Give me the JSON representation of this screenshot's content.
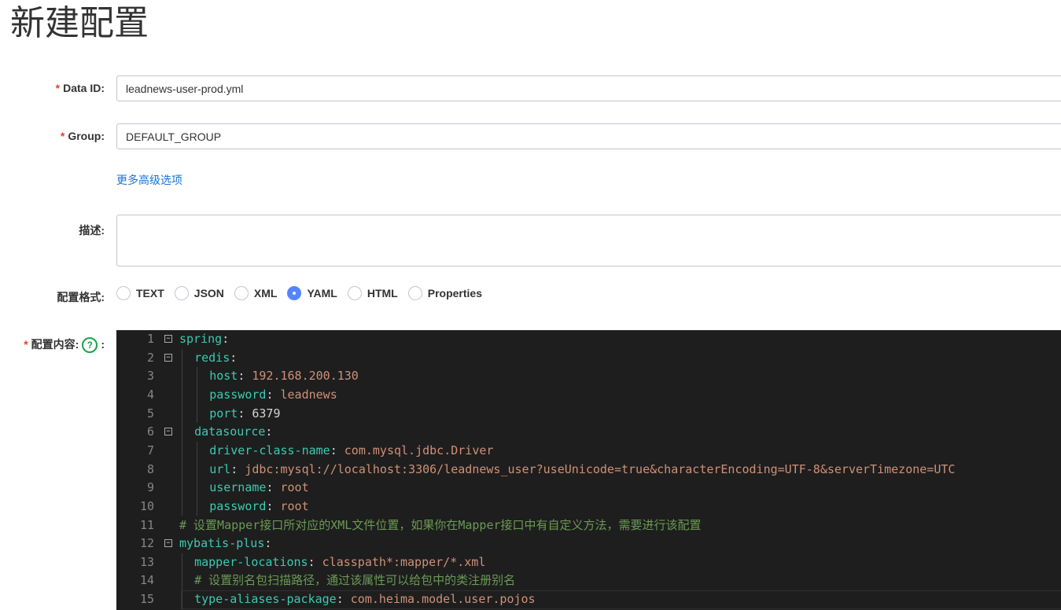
{
  "page_title": "新建配置",
  "form": {
    "data_id": {
      "label": "Data ID:",
      "value": "leadnews-user-prod.yml"
    },
    "group": {
      "label": "Group:",
      "value": "DEFAULT_GROUP"
    },
    "advanced_link": "更多高级选项",
    "description": {
      "label": "描述:",
      "value": ""
    },
    "format": {
      "label": "配置格式:",
      "options": [
        "TEXT",
        "JSON",
        "XML",
        "YAML",
        "HTML",
        "Properties"
      ],
      "selected": "YAML"
    },
    "content": {
      "label": "配置内容:",
      "help_icon": "?",
      "colon": ":"
    },
    "required_mark": "*"
  },
  "editor": {
    "lines": [
      {
        "n": "1",
        "indent": 0,
        "fold": true,
        "key": "spring",
        "value": ""
      },
      {
        "n": "2",
        "indent": 1,
        "fold": true,
        "key": "redis",
        "value": ""
      },
      {
        "n": "3",
        "indent": 2,
        "key": "host",
        "value": "192.168.200.130"
      },
      {
        "n": "4",
        "indent": 2,
        "key": "password",
        "value": "leadnews"
      },
      {
        "n": "5",
        "indent": 2,
        "key": "port",
        "value": "6379",
        "num": true
      },
      {
        "n": "6",
        "indent": 1,
        "fold": true,
        "key": "datasource",
        "value": ""
      },
      {
        "n": "7",
        "indent": 2,
        "key": "driver-class-name",
        "value": "com.mysql.jdbc.Driver"
      },
      {
        "n": "8",
        "indent": 2,
        "key": "url",
        "value": "jdbc:mysql://localhost:3306/leadnews_user?useUnicode=true&characterEncoding=UTF-8&serverTimezone=UTC"
      },
      {
        "n": "9",
        "indent": 2,
        "key": "username",
        "value": "root"
      },
      {
        "n": "10",
        "indent": 2,
        "key": "password",
        "value": "root"
      },
      {
        "n": "11",
        "indent": 0,
        "comment": "# 设置Mapper接口所对应的XML文件位置，如果你在Mapper接口中有自定义方法，需要进行该配置"
      },
      {
        "n": "12",
        "indent": 0,
        "fold": true,
        "key": "mybatis-plus",
        "value": ""
      },
      {
        "n": "13",
        "indent": 1,
        "key": "mapper-locations",
        "value": "classpath*:mapper/*.xml"
      },
      {
        "n": "14",
        "indent": 1,
        "comment": "# 设置别名包扫描路径，通过该属性可以给包中的类注册别名"
      },
      {
        "n": "15",
        "indent": 1,
        "key": "type-aliases-package",
        "value": "com.heima.model.user.pojos",
        "current": true
      }
    ]
  }
}
